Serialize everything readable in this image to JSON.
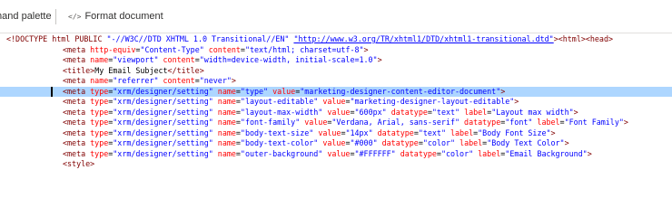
{
  "toolbar": {
    "command_palette_label": "mand palette",
    "format_icon": "</>",
    "format_document_label": "Format document"
  },
  "editor": {
    "lines": [
      {
        "indent": false,
        "tokens": [
          {
            "t": "bracket",
            "v": "<!DOCTYPE "
          },
          {
            "t": "tag",
            "v": "html PUBLIC "
          },
          {
            "t": "val",
            "v": "\"-//W3C//DTD XHTML 1.0 Transitional//EN\" "
          },
          {
            "t": "link",
            "v": "\"http://www.w3.org/TR/xhtml1/DTD/xhtml1-transitional.dtd\""
          },
          {
            "t": "bracket",
            "v": "><"
          },
          {
            "t": "tag",
            "v": "html"
          },
          {
            "t": "bracket",
            "v": "><"
          },
          {
            "t": "tag",
            "v": "head"
          },
          {
            "t": "bracket",
            "v": ">"
          }
        ]
      },
      {
        "indent": true,
        "tokens": [
          {
            "t": "bracket",
            "v": "<"
          },
          {
            "t": "tag",
            "v": "meta "
          },
          {
            "t": "attr",
            "v": "http-equiv"
          },
          {
            "t": "txt",
            "v": "="
          },
          {
            "t": "val",
            "v": "\"Content-Type\" "
          },
          {
            "t": "attr",
            "v": "content"
          },
          {
            "t": "txt",
            "v": "="
          },
          {
            "t": "val",
            "v": "\"text/html; charset=utf-8\""
          },
          {
            "t": "bracket",
            "v": ">"
          }
        ]
      },
      {
        "indent": true,
        "tokens": [
          {
            "t": "bracket",
            "v": "<"
          },
          {
            "t": "tag",
            "v": "meta "
          },
          {
            "t": "attr",
            "v": "name"
          },
          {
            "t": "txt",
            "v": "="
          },
          {
            "t": "val",
            "v": "\"viewport\" "
          },
          {
            "t": "attr",
            "v": "content"
          },
          {
            "t": "txt",
            "v": "="
          },
          {
            "t": "val",
            "v": "\"width=device-width, initial-scale=1.0\""
          },
          {
            "t": "bracket",
            "v": ">"
          }
        ]
      },
      {
        "indent": true,
        "tokens": [
          {
            "t": "bracket",
            "v": "<"
          },
          {
            "t": "tag",
            "v": "title"
          },
          {
            "t": "bracket",
            "v": ">"
          },
          {
            "t": "txt",
            "v": "My Email Subject"
          },
          {
            "t": "bracket",
            "v": "</"
          },
          {
            "t": "tag",
            "v": "title"
          },
          {
            "t": "bracket",
            "v": ">"
          }
        ]
      },
      {
        "indent": true,
        "tokens": [
          {
            "t": "bracket",
            "v": "<"
          },
          {
            "t": "tag",
            "v": "meta "
          },
          {
            "t": "attr",
            "v": "name"
          },
          {
            "t": "txt",
            "v": "="
          },
          {
            "t": "val",
            "v": "\"referrer\" "
          },
          {
            "t": "attr",
            "v": "content"
          },
          {
            "t": "txt",
            "v": "="
          },
          {
            "t": "val",
            "v": "\"never\""
          },
          {
            "t": "bracket",
            "v": ">"
          }
        ]
      },
      {
        "indent": true,
        "highlight": true,
        "cursor": true,
        "tokens": [
          {
            "t": "bracket",
            "v": "<"
          },
          {
            "t": "tag",
            "v": "meta "
          },
          {
            "t": "attr",
            "v": "type"
          },
          {
            "t": "txt",
            "v": "="
          },
          {
            "t": "val",
            "v": "\"xrm/designer/setting\" "
          },
          {
            "t": "attr",
            "v": "name"
          },
          {
            "t": "txt",
            "v": "="
          },
          {
            "t": "val",
            "v": "\"type\" "
          },
          {
            "t": "attr",
            "v": "value"
          },
          {
            "t": "txt",
            "v": "="
          },
          {
            "t": "val",
            "v": "\"marketing-designer-content-editor-document\""
          },
          {
            "t": "bracket",
            "v": ">"
          }
        ]
      },
      {
        "indent": true,
        "tokens": [
          {
            "t": "bracket",
            "v": "<"
          },
          {
            "t": "tag",
            "v": "meta "
          },
          {
            "t": "attr",
            "v": "type"
          },
          {
            "t": "txt",
            "v": "="
          },
          {
            "t": "val",
            "v": "\"xrm/designer/setting\" "
          },
          {
            "t": "attr",
            "v": "name"
          },
          {
            "t": "txt",
            "v": "="
          },
          {
            "t": "val",
            "v": "\"layout-editable\" "
          },
          {
            "t": "attr",
            "v": "value"
          },
          {
            "t": "txt",
            "v": "="
          },
          {
            "t": "val",
            "v": "\"marketing-designer-layout-editable\""
          },
          {
            "t": "bracket",
            "v": ">"
          }
        ]
      },
      {
        "indent": true,
        "tokens": [
          {
            "t": "bracket",
            "v": "<"
          },
          {
            "t": "tag",
            "v": "meta "
          },
          {
            "t": "attr",
            "v": "type"
          },
          {
            "t": "txt",
            "v": "="
          },
          {
            "t": "val",
            "v": "\"xrm/designer/setting\" "
          },
          {
            "t": "attr",
            "v": "name"
          },
          {
            "t": "txt",
            "v": "="
          },
          {
            "t": "val",
            "v": "\"layout-max-width\" "
          },
          {
            "t": "attr",
            "v": "value"
          },
          {
            "t": "txt",
            "v": "="
          },
          {
            "t": "val",
            "v": "\"600px\" "
          },
          {
            "t": "attr",
            "v": "datatype"
          },
          {
            "t": "txt",
            "v": "="
          },
          {
            "t": "val",
            "v": "\"text\" "
          },
          {
            "t": "attr",
            "v": "label"
          },
          {
            "t": "txt",
            "v": "="
          },
          {
            "t": "val",
            "v": "\"Layout max width\""
          },
          {
            "t": "bracket",
            "v": ">"
          }
        ]
      },
      {
        "indent": true,
        "tokens": [
          {
            "t": "bracket",
            "v": "<"
          },
          {
            "t": "tag",
            "v": "meta "
          },
          {
            "t": "attr",
            "v": "type"
          },
          {
            "t": "txt",
            "v": "="
          },
          {
            "t": "val",
            "v": "\"xrm/designer/setting\" "
          },
          {
            "t": "attr",
            "v": "name"
          },
          {
            "t": "txt",
            "v": "="
          },
          {
            "t": "val",
            "v": "\"font-family\" "
          },
          {
            "t": "attr",
            "v": "value"
          },
          {
            "t": "txt",
            "v": "="
          },
          {
            "t": "val",
            "v": "\"Verdana, Arial, sans-serif\" "
          },
          {
            "t": "attr",
            "v": "datatype"
          },
          {
            "t": "txt",
            "v": "="
          },
          {
            "t": "val",
            "v": "\"font\" "
          },
          {
            "t": "attr",
            "v": "label"
          },
          {
            "t": "txt",
            "v": "="
          },
          {
            "t": "val",
            "v": "\"Font Family\""
          },
          {
            "t": "bracket",
            "v": ">"
          }
        ]
      },
      {
        "indent": true,
        "tokens": [
          {
            "t": "bracket",
            "v": "<"
          },
          {
            "t": "tag",
            "v": "meta "
          },
          {
            "t": "attr",
            "v": "type"
          },
          {
            "t": "txt",
            "v": "="
          },
          {
            "t": "val",
            "v": "\"xrm/designer/setting\" "
          },
          {
            "t": "attr",
            "v": "name"
          },
          {
            "t": "txt",
            "v": "="
          },
          {
            "t": "val",
            "v": "\"body-text-size\" "
          },
          {
            "t": "attr",
            "v": "value"
          },
          {
            "t": "txt",
            "v": "="
          },
          {
            "t": "val",
            "v": "\"14px\" "
          },
          {
            "t": "attr",
            "v": "datatype"
          },
          {
            "t": "txt",
            "v": "="
          },
          {
            "t": "val",
            "v": "\"text\" "
          },
          {
            "t": "attr",
            "v": "label"
          },
          {
            "t": "txt",
            "v": "="
          },
          {
            "t": "val",
            "v": "\"Body Font Size\""
          },
          {
            "t": "bracket",
            "v": ">"
          }
        ]
      },
      {
        "indent": true,
        "tokens": [
          {
            "t": "bracket",
            "v": "<"
          },
          {
            "t": "tag",
            "v": "meta "
          },
          {
            "t": "attr",
            "v": "type"
          },
          {
            "t": "txt",
            "v": "="
          },
          {
            "t": "val",
            "v": "\"xrm/designer/setting\" "
          },
          {
            "t": "attr",
            "v": "name"
          },
          {
            "t": "txt",
            "v": "="
          },
          {
            "t": "val",
            "v": "\"body-text-color\" "
          },
          {
            "t": "attr",
            "v": "value"
          },
          {
            "t": "txt",
            "v": "="
          },
          {
            "t": "val",
            "v": "\"#000\" "
          },
          {
            "t": "attr",
            "v": "datatype"
          },
          {
            "t": "txt",
            "v": "="
          },
          {
            "t": "val",
            "v": "\"color\" "
          },
          {
            "t": "attr",
            "v": "label"
          },
          {
            "t": "txt",
            "v": "="
          },
          {
            "t": "val",
            "v": "\"Body Text Color\""
          },
          {
            "t": "bracket",
            "v": ">"
          }
        ]
      },
      {
        "indent": true,
        "tokens": [
          {
            "t": "bracket",
            "v": "<"
          },
          {
            "t": "tag",
            "v": "meta "
          },
          {
            "t": "attr",
            "v": "type"
          },
          {
            "t": "txt",
            "v": "="
          },
          {
            "t": "val",
            "v": "\"xrm/designer/setting\" "
          },
          {
            "t": "attr",
            "v": "name"
          },
          {
            "t": "txt",
            "v": "="
          },
          {
            "t": "val",
            "v": "\"outer-background\" "
          },
          {
            "t": "attr",
            "v": "value"
          },
          {
            "t": "txt",
            "v": "="
          },
          {
            "t": "val",
            "v": "\"#FFFFFF\" "
          },
          {
            "t": "attr",
            "v": "datatype"
          },
          {
            "t": "txt",
            "v": "="
          },
          {
            "t": "val",
            "v": "\"color\" "
          },
          {
            "t": "attr",
            "v": "label"
          },
          {
            "t": "txt",
            "v": "="
          },
          {
            "t": "val",
            "v": "\"Email Background\""
          },
          {
            "t": "bracket",
            "v": ">"
          }
        ]
      },
      {
        "indent": true,
        "tokens": [
          {
            "t": "bracket",
            "v": "<"
          },
          {
            "t": "tag",
            "v": "style"
          },
          {
            "t": "bracket",
            "v": ">"
          }
        ]
      }
    ]
  },
  "colors": {
    "tag": "#800000",
    "attribute": "#ff0000",
    "value": "#0000ff",
    "selection": "#add6ff"
  }
}
